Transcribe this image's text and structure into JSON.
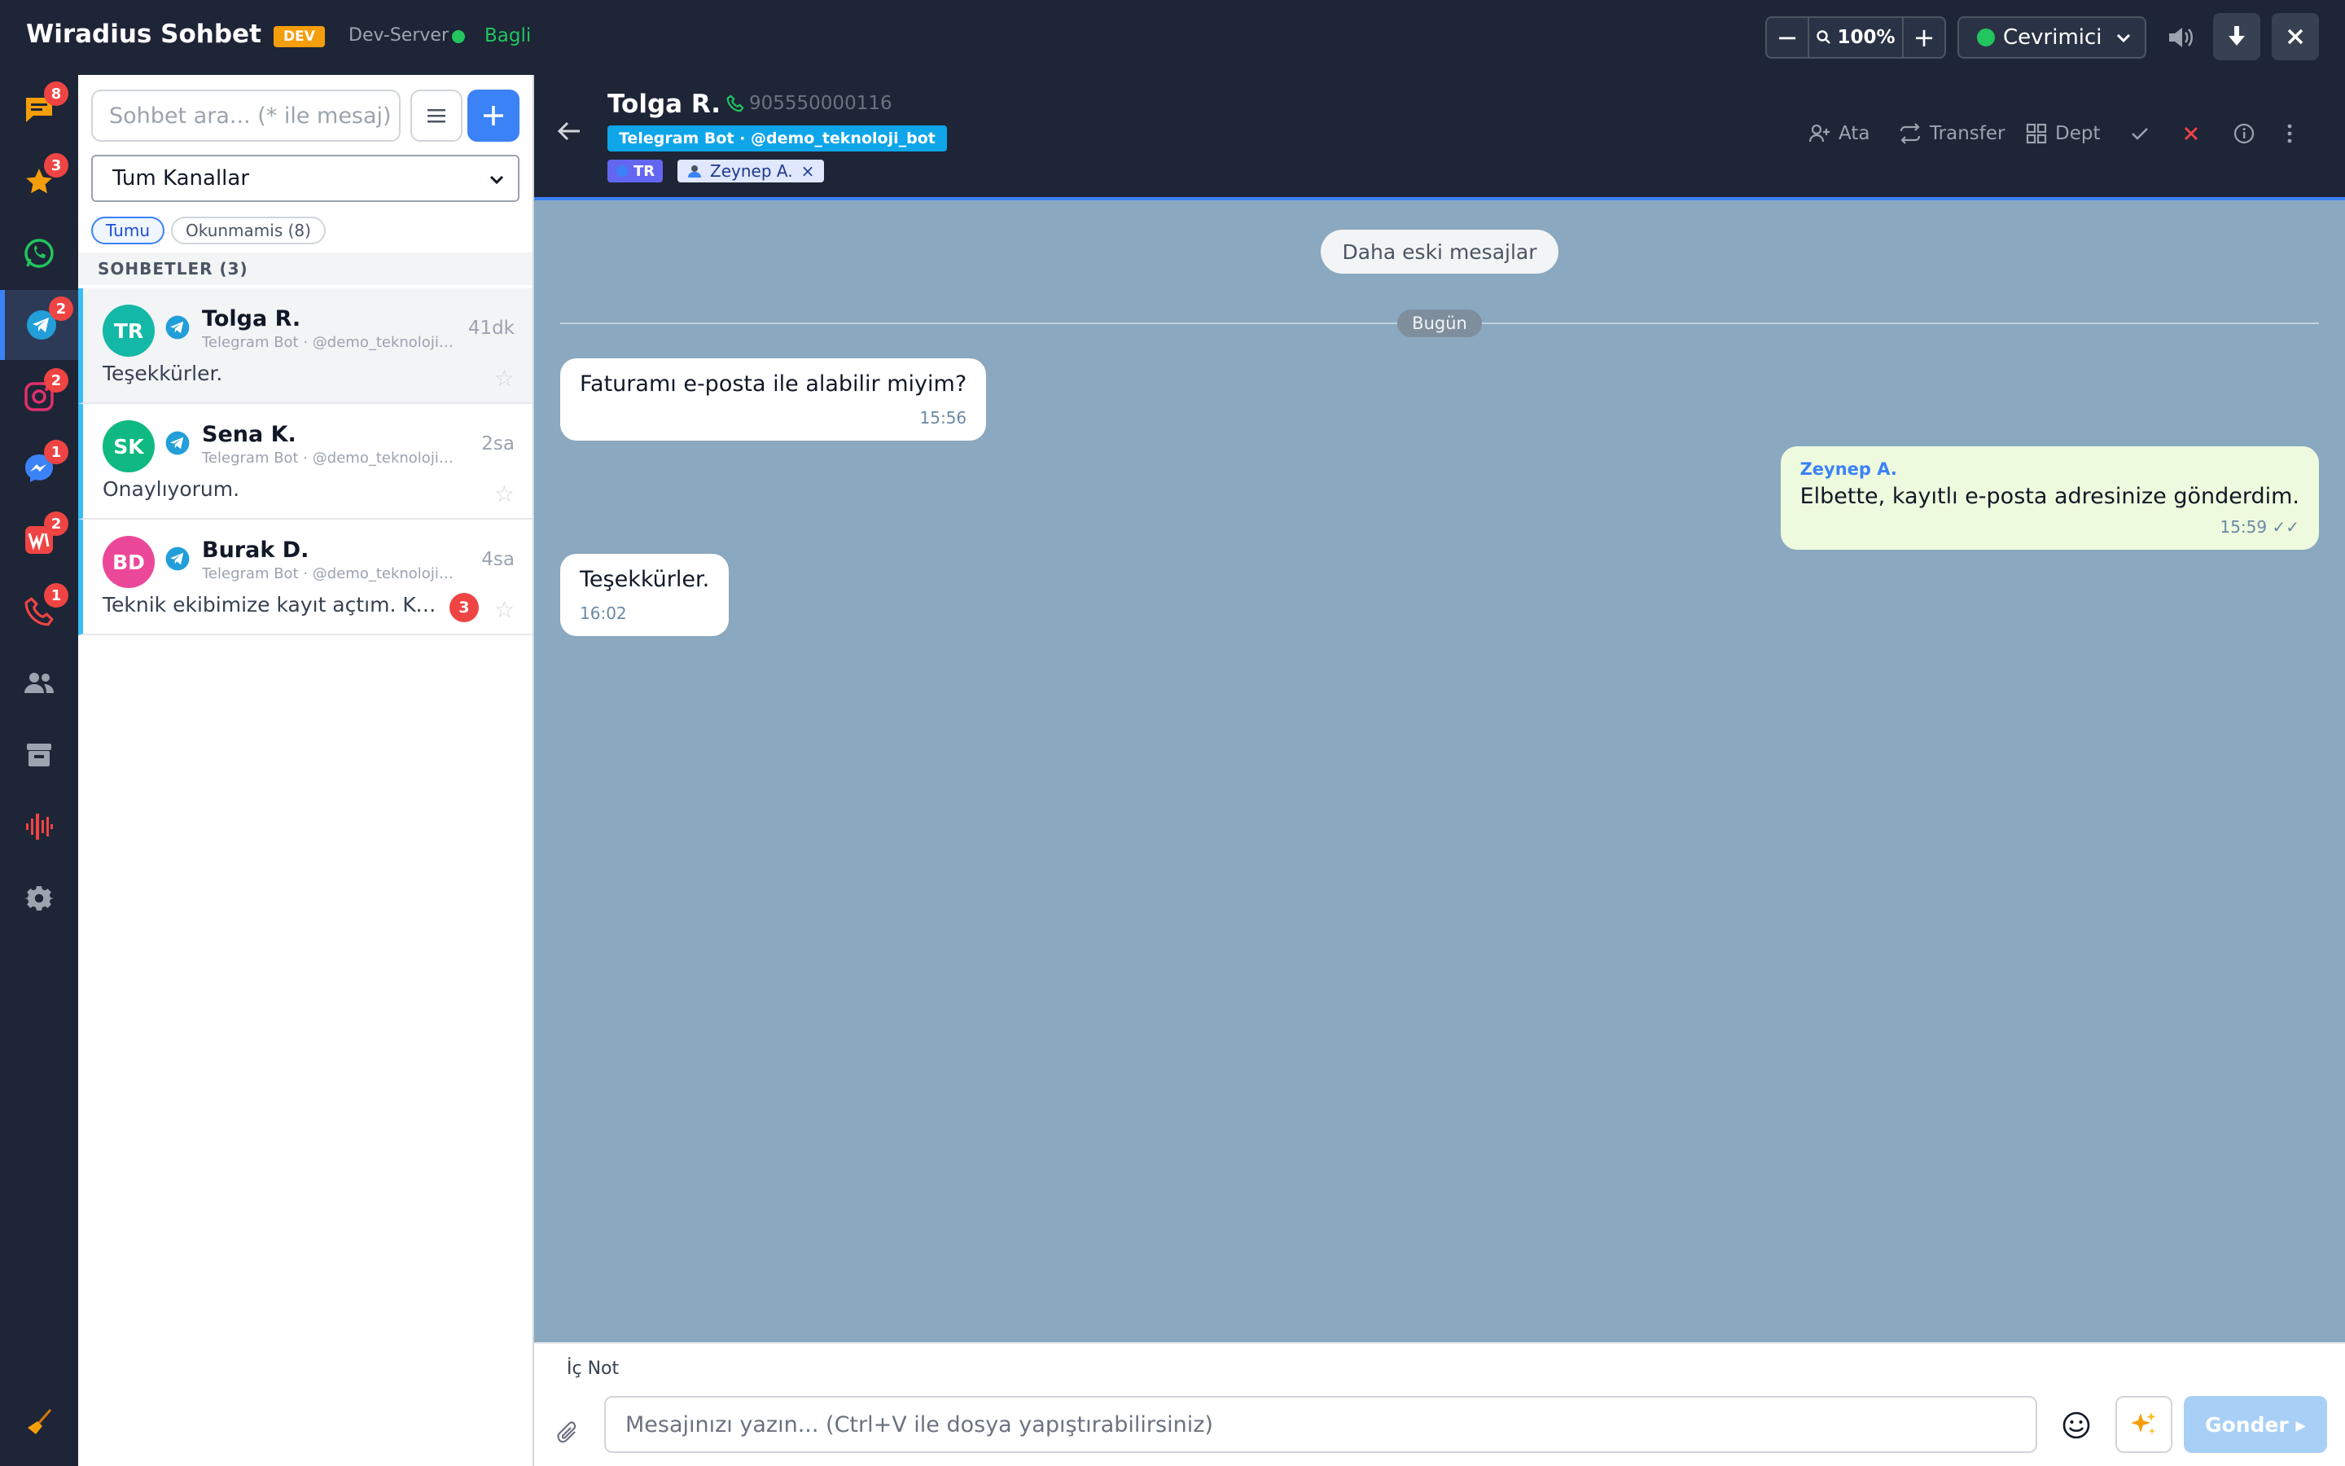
{
  "app": {
    "title": "Wiradius Sohbet",
    "env_badge": "DEV",
    "server": "Dev-Server",
    "connection": "Bagli",
    "zoom": "100%",
    "status": "Cevrimici"
  },
  "rail": {
    "badges": {
      "chats": "8",
      "starred": "3",
      "telegram": "2",
      "instagram": "2",
      "messenger": "1",
      "web": "2",
      "calls": "1"
    }
  },
  "list": {
    "search_placeholder": "Sohbet ara... (* ile mesaj)",
    "channel_filter": "Tum Kanallar",
    "chip_all": "Tumu",
    "chip_unread": "Okunmamis (8)",
    "section_title": "SOHBETLER (3)",
    "conversations": [
      {
        "initials": "TR",
        "name": "Tolga R.",
        "sub": "Telegram Bot · @demo_teknoloji_bot",
        "time": "41dk",
        "preview": "Teşekkürler.",
        "unread": "",
        "color": "#14b8a6"
      },
      {
        "initials": "SK",
        "name": "Sena K.",
        "sub": "Telegram Bot · @demo_teknoloji_bot",
        "time": "2sa",
        "preview": "Onaylıyorum.",
        "unread": "",
        "color": "#10b981"
      },
      {
        "initials": "BD",
        "name": "Burak D.",
        "sub": "Telegram Bot · @demo_teknoloji_bot",
        "time": "4sa",
        "preview": "Teknik ekibimize kayıt açtım. Kaydınız oluşturuldu.",
        "unread": "3",
        "color": "#ec4899"
      }
    ]
  },
  "chat": {
    "contact_name": "Tolga R.",
    "phone": "905550000116",
    "bot_tag": "Telegram Bot · @demo_teknoloji_bot",
    "lang_tag": "TR",
    "agent_tag": "Zeynep A.",
    "actions": {
      "assign": "Ata",
      "transfer": "Transfer",
      "dept": "Dept"
    },
    "older_messages": "Daha eski mesajlar",
    "day_label": "Bugün",
    "messages": [
      {
        "text": "Faturamı e-posta ile alabilir miyim?",
        "time": "15:56"
      },
      {
        "sender": "Zeynep A.",
        "text": "Elbette, kayıtlı e-posta adresinize gönderdim.",
        "time": "15:59 ✓✓"
      },
      {
        "text": "Teşekkürler.",
        "time": "16:02"
      }
    ]
  },
  "composer": {
    "note_label": "İç Not",
    "placeholder": "Mesajınızı yazın... (Ctrl+V ile dosya yapıştırabilirsiniz)",
    "send_label": "Gonder ▸"
  }
}
